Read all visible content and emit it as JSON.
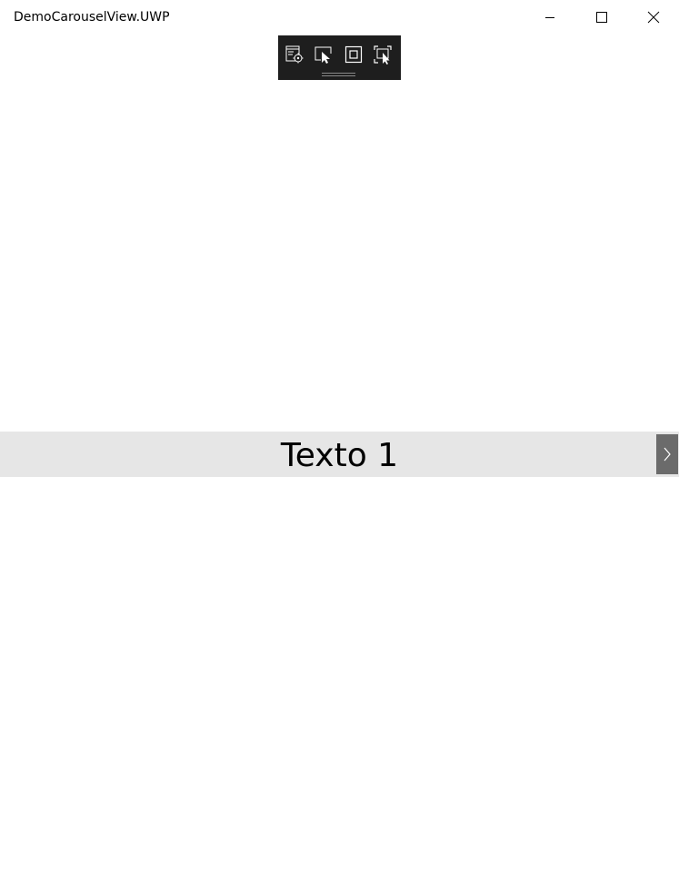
{
  "window": {
    "title": "DemoCarouselView.UWP",
    "caption_buttons": {
      "minimize_icon": "minimize-icon",
      "maximize_icon": "maximize-icon",
      "close_icon": "close-icon"
    }
  },
  "debug_toolbar": {
    "tools": [
      {
        "icon": "visual-tree-select-icon"
      },
      {
        "icon": "select-element-icon"
      },
      {
        "icon": "display-layout-adorners-icon"
      },
      {
        "icon": "track-focus-icon"
      }
    ]
  },
  "carousel": {
    "current_text": "Texto 1",
    "next_icon": "chevron-right-icon",
    "colors": {
      "band": "#e6e6e6",
      "arrow_bg": "#6b6b6b",
      "arrow_fg": "#ffffff"
    }
  }
}
